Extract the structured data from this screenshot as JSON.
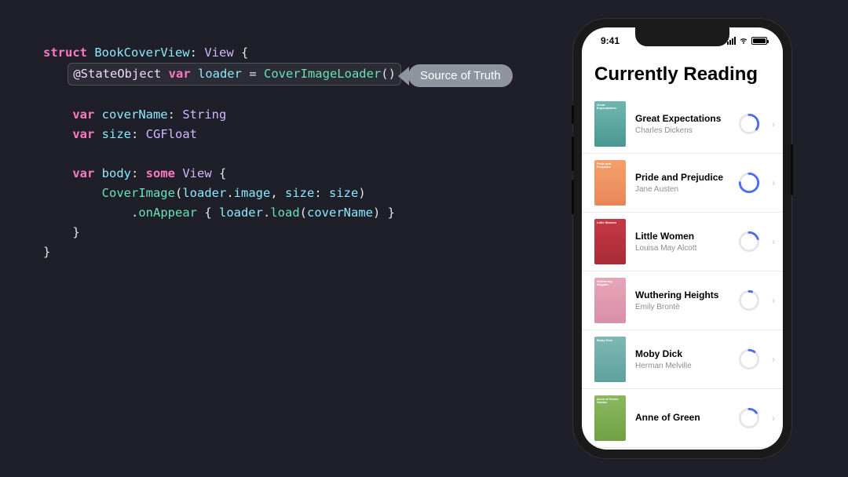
{
  "code": {
    "tokens": [
      [
        {
          "t": "struct ",
          "c": "kw-pink"
        },
        {
          "t": "BookCoverView",
          "c": "kw-cyan"
        },
        {
          "t": ": ",
          "c": "punct"
        },
        {
          "t": "View",
          "c": "type"
        },
        {
          "t": " {",
          "c": "punct"
        }
      ],
      "HL",
      [],
      [
        {
          "t": "    ",
          "c": ""
        },
        {
          "t": "var ",
          "c": "kw-pink"
        },
        {
          "t": "coverName",
          "c": "kw-cyan"
        },
        {
          "t": ": ",
          "c": "punct"
        },
        {
          "t": "String",
          "c": "type"
        }
      ],
      [
        {
          "t": "    ",
          "c": ""
        },
        {
          "t": "var ",
          "c": "kw-pink"
        },
        {
          "t": "size",
          "c": "kw-cyan"
        },
        {
          "t": ": ",
          "c": "punct"
        },
        {
          "t": "CGFloat",
          "c": "type"
        }
      ],
      [],
      [
        {
          "t": "    ",
          "c": ""
        },
        {
          "t": "var ",
          "c": "kw-pink"
        },
        {
          "t": "body",
          "c": "kw-cyan"
        },
        {
          "t": ": ",
          "c": "punct"
        },
        {
          "t": "some ",
          "c": "kw-pink"
        },
        {
          "t": "View",
          "c": "type"
        },
        {
          "t": " {",
          "c": "punct"
        }
      ],
      [
        {
          "t": "        ",
          "c": ""
        },
        {
          "t": "CoverImage",
          "c": "kw-green"
        },
        {
          "t": "(",
          "c": "punct"
        },
        {
          "t": "loader",
          "c": "kw-cyan"
        },
        {
          "t": ".",
          "c": "punct"
        },
        {
          "t": "image",
          "c": "kw-cyan"
        },
        {
          "t": ", ",
          "c": "punct"
        },
        {
          "t": "size",
          "c": "kw-cyan"
        },
        {
          "t": ": ",
          "c": "punct"
        },
        {
          "t": "size",
          "c": "kw-cyan"
        },
        {
          "t": ")",
          "c": "punct"
        }
      ],
      [
        {
          "t": "            .",
          "c": "punct"
        },
        {
          "t": "onAppear",
          "c": "kw-green"
        },
        {
          "t": " { ",
          "c": "punct"
        },
        {
          "t": "loader",
          "c": "kw-cyan"
        },
        {
          "t": ".",
          "c": "punct"
        },
        {
          "t": "load",
          "c": "kw-green"
        },
        {
          "t": "(",
          "c": "punct"
        },
        {
          "t": "coverName",
          "c": "kw-cyan"
        },
        {
          "t": ") }",
          "c": "punct"
        }
      ],
      [
        {
          "t": "    }",
          "c": "punct"
        }
      ],
      [
        {
          "t": "}",
          "c": "punct"
        }
      ]
    ],
    "highlighted": [
      {
        "t": "@StateObject ",
        "c": "attr"
      },
      {
        "t": "var ",
        "c": "kw-pink"
      },
      {
        "t": "loader",
        "c": "kw-cyan"
      },
      {
        "t": " = ",
        "c": "punct"
      },
      {
        "t": "CoverImageLoader",
        "c": "kw-green"
      },
      {
        "t": "()",
        "c": "punct"
      }
    ]
  },
  "callout": {
    "text": "Source of Truth"
  },
  "phone": {
    "time": "9:41",
    "app_title": "Currently Reading",
    "books": [
      {
        "title": "Great Expectations",
        "author": "Charles Dickens",
        "coverClass": "cover-teal",
        "coverText": "Great Expectations",
        "progress": 0.35
      },
      {
        "title": "Pride and Prejudice",
        "author": "Jane Austen",
        "coverClass": "cover-orange",
        "coverText": "Pride and Prejudice",
        "progress": 0.75
      },
      {
        "title": "Little Women",
        "author": "Louisa May Alcott",
        "coverClass": "cover-red",
        "coverText": "Little Women",
        "progress": 0.2
      },
      {
        "title": "Wuthering Heights",
        "author": "Emily Brontë",
        "coverClass": "cover-pink",
        "coverText": "Wuthering Heights",
        "progress": 0.05
      },
      {
        "title": "Moby Dick",
        "author": "Herman Melville",
        "coverClass": "cover-teal2",
        "coverText": "Moby Dick",
        "progress": 0.1
      },
      {
        "title": "Anne of Green",
        "author": "",
        "coverClass": "cover-green",
        "coverText": "Anne of Green Gables",
        "progress": 0.15
      }
    ]
  }
}
